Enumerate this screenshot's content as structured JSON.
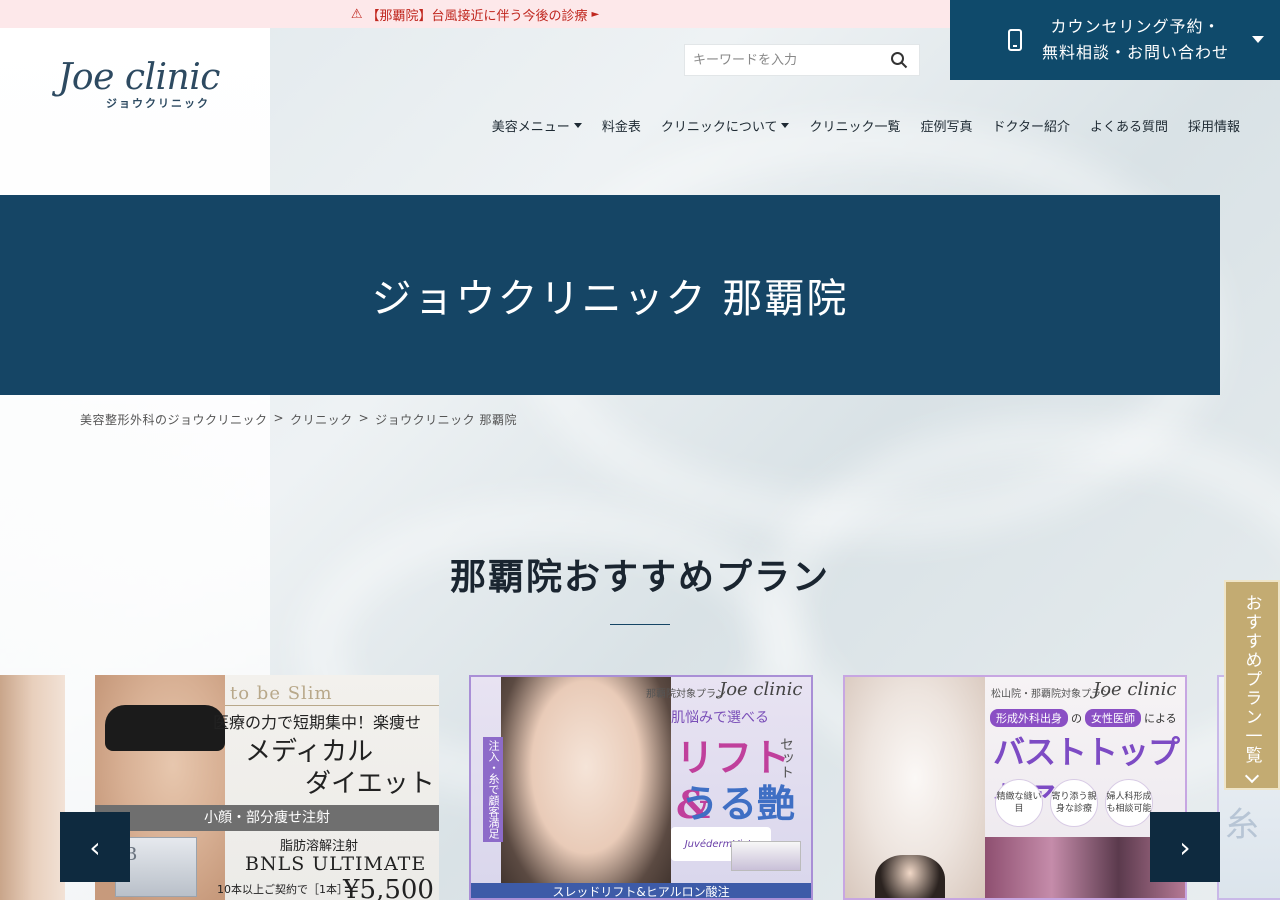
{
  "alert": {
    "text": "【那覇院】台風接近に伴う今後の診療",
    "arrow": "►"
  },
  "cta": {
    "line1": "カウンセリング予約・",
    "line2": "無料相談・お問い合わせ"
  },
  "logo": {
    "main": "Joe clinic",
    "sub": "ジョウクリニック"
  },
  "search": {
    "placeholder": "キーワードを入力"
  },
  "nav": {
    "items": [
      {
        "label": "美容メニュー"
      },
      {
        "label": "料金表"
      },
      {
        "label": "クリニックについて"
      },
      {
        "label": "クリニック一覧"
      },
      {
        "label": "症例写真"
      },
      {
        "label": "ドクター紹介"
      },
      {
        "label": "よくある質問"
      },
      {
        "label": "採用情報"
      }
    ]
  },
  "hero": {
    "title": "ジョウクリニック 那覇院"
  },
  "breadcrumb": {
    "home": "美容整形外科のジョウクリニック",
    "sep": ">",
    "clinic": "クリニック",
    "current": "ジョウクリニック 那覇院"
  },
  "section": {
    "title": "那覇院おすすめプラン"
  },
  "cards": {
    "card1": {
      "tag": "to be Slim",
      "line1": "医療の力で短期集中！楽痩せ",
      "line2": "メディカル",
      "line3": "ダイエット",
      "band": "小顔・部分痩せ注射",
      "line4": "脂肪溶解注射",
      "line5": "BNLS ULTIMATE",
      "line6": "10本以上ご契約で［1本］",
      "price": "¥5,500",
      "box": "B"
    },
    "card2": {
      "header": "那覇院対象プラン",
      "logo": "Joe clinic",
      "line1": "肌悩みで選べる",
      "big1": "リフト&",
      "big2": "うる艶",
      "set": "セット",
      "vertical": "注入・糸で顧客満足",
      "product": "JuvédermVista",
      "bottom": "スレッドリフト&ヒアルロン酸注"
    },
    "card3": {
      "header": "松山院・那覇院対象プラン",
      "logo": "Joe clinic",
      "pill1": "形成外科出身",
      "mid": "の",
      "pill2": "女性医師",
      "suffix": "による",
      "big": "バストトップケア",
      "c1": "精緻な縫い目",
      "c2": "寄り添う親身な診療",
      "c3": "婦人科形成も相談可能"
    },
    "card4": {
      "kanji": "糸"
    }
  },
  "carousel": {
    "prev": "‹",
    "next": "›"
  },
  "sidetab": {
    "label": "おすすめプラン一覧"
  }
}
